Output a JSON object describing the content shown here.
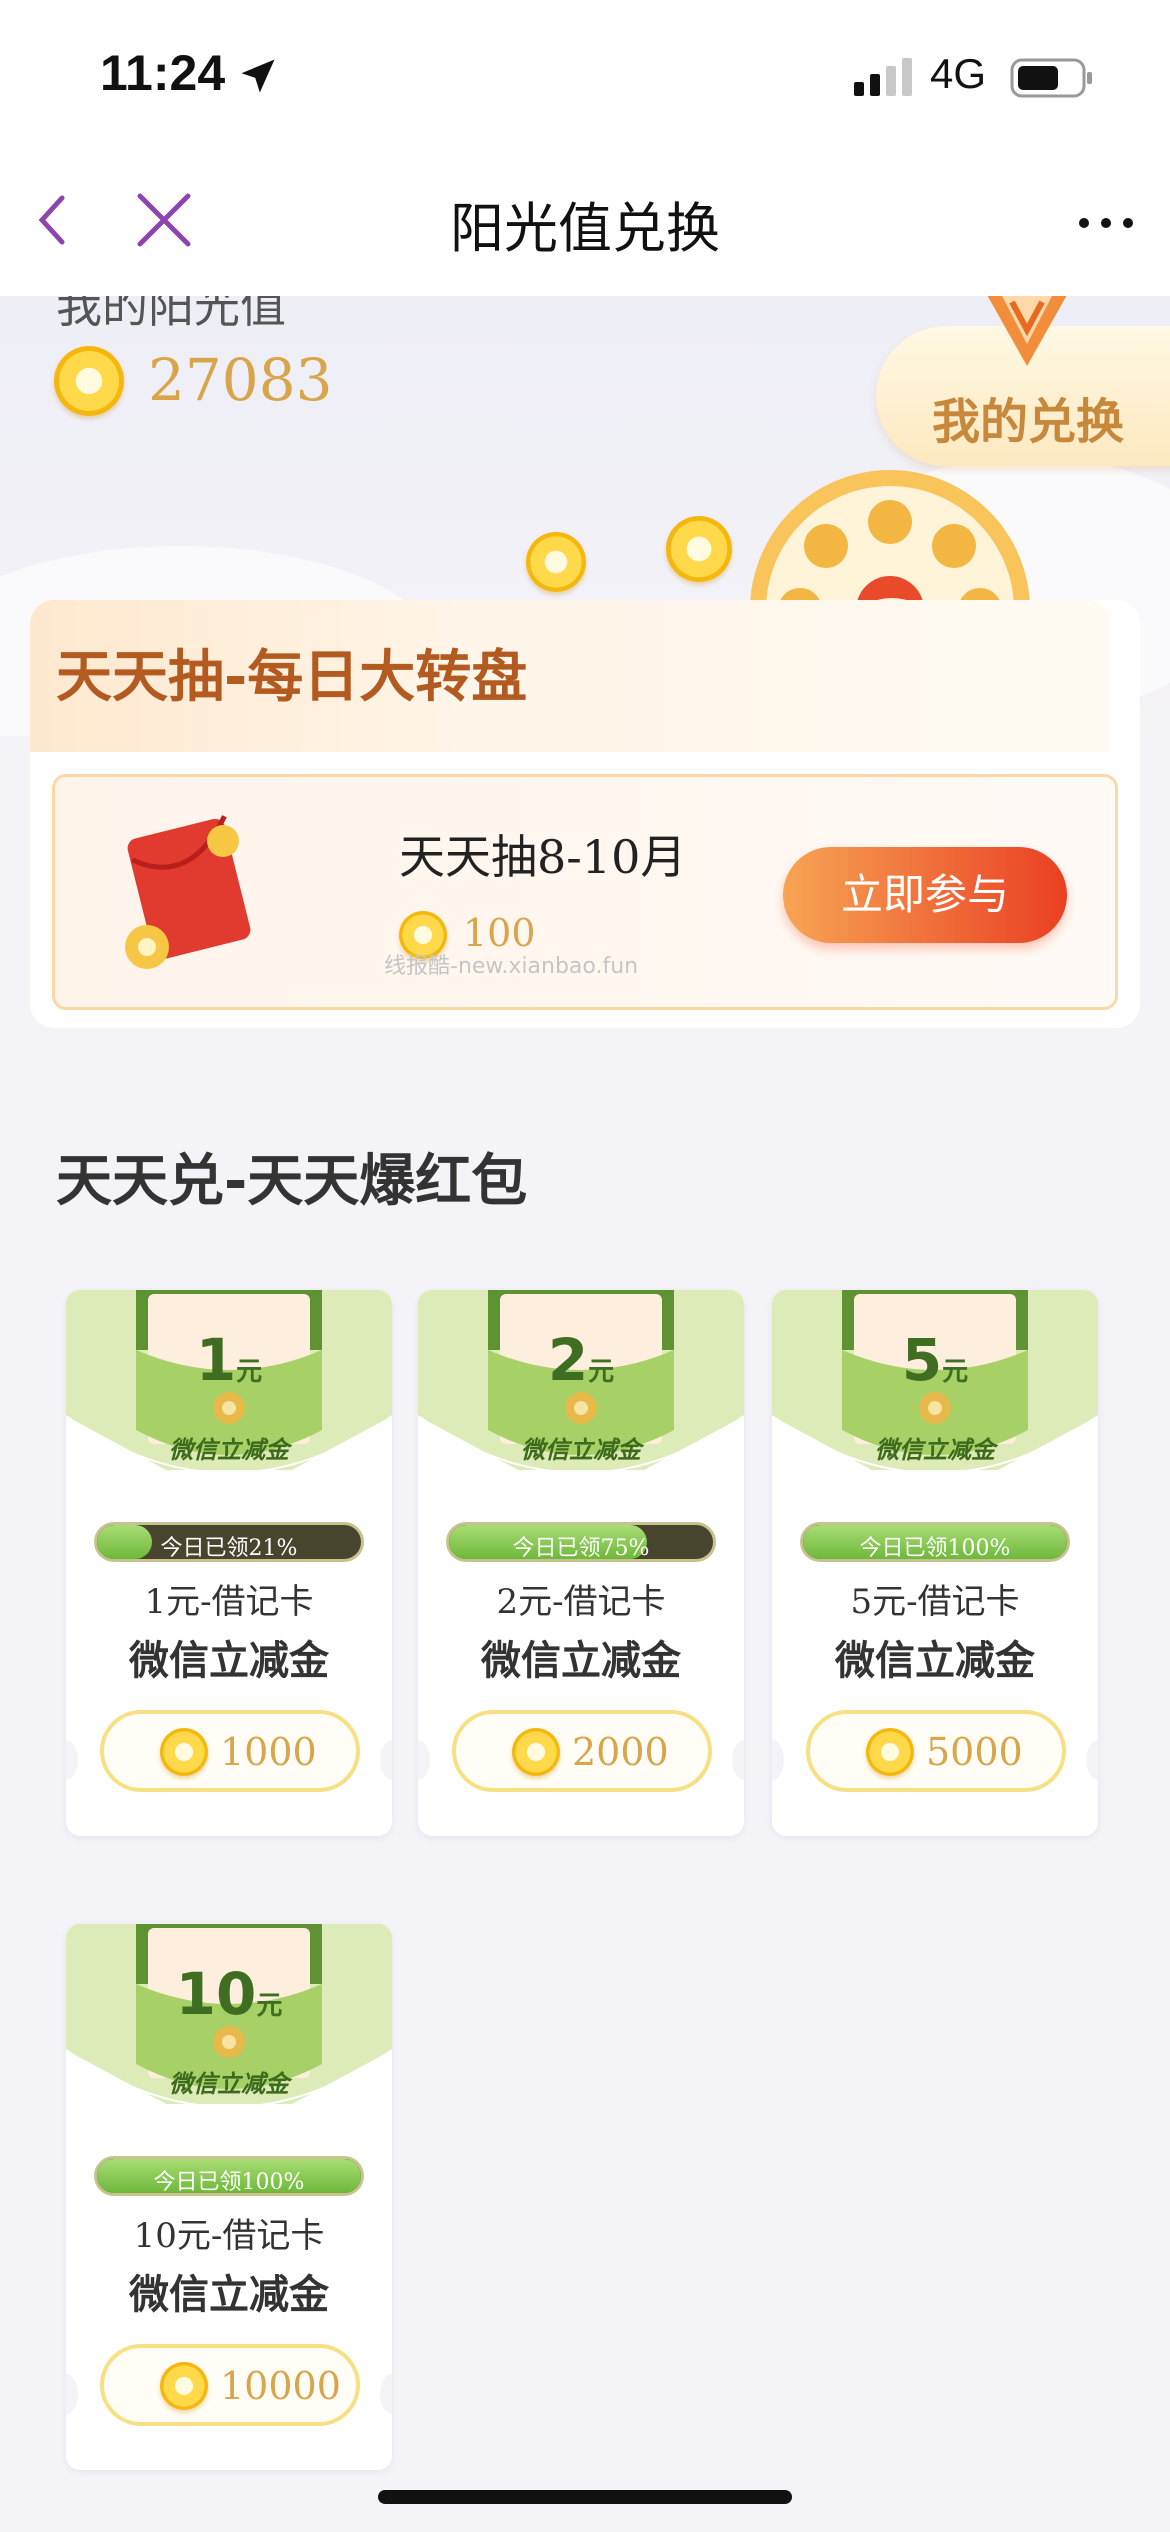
{
  "status_bar": {
    "time": "11:24",
    "network": "4G"
  },
  "nav": {
    "title": "阳光值兑换"
  },
  "balance": {
    "label": "我的阳光值",
    "value": "27083",
    "my_exchange_label": "我的兑换"
  },
  "lottery": {
    "section_title": "天天抽-每日大转盘",
    "item_name": "天天抽8-10月",
    "item_cost": "100",
    "join_label": "立即参与",
    "watermark": "线报酷-new.xianbao.fun"
  },
  "exchange": {
    "section_title": "天天兑-天天爆红包",
    "cards": [
      {
        "denom": "1",
        "unit": "元",
        "env_label": "微信立减金",
        "progress_text": "今日已领21%",
        "progress": 0.21,
        "sub": "1元-借记卡",
        "name": "微信立减金",
        "price": "1000"
      },
      {
        "denom": "2",
        "unit": "元",
        "env_label": "微信立减金",
        "progress_text": "今日已领75%",
        "progress": 0.75,
        "sub": "2元-借记卡",
        "name": "微信立减金",
        "price": "2000"
      },
      {
        "denom": "5",
        "unit": "元",
        "env_label": "微信立减金",
        "progress_text": "今日已领100%",
        "progress": 1.0,
        "sub": "5元-借记卡",
        "name": "微信立减金",
        "price": "5000"
      },
      {
        "denom": "10",
        "unit": "元",
        "env_label": "微信立减金",
        "progress_text": "今日已领100%",
        "progress": 1.0,
        "sub": "10元-借记卡",
        "name": "微信立减金",
        "price": "10000"
      }
    ]
  },
  "colors": {
    "accent_orange": "#ea3f23",
    "coin_gold": "#d9a54b",
    "nav_purple": "#8e44ad",
    "green_progress": "#6eb83b"
  },
  "icons": [
    "location-arrow-icon",
    "signal-icon",
    "battery-icon",
    "back-chevron-icon",
    "close-icon",
    "more-icon",
    "sun-coin-icon",
    "red-packet-icon",
    "prize-wheel-icon"
  ]
}
